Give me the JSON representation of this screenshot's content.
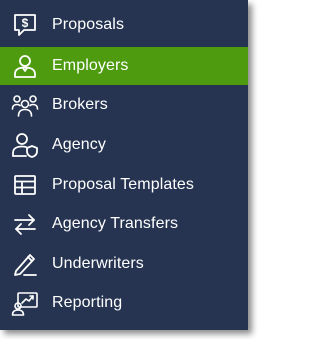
{
  "menu": {
    "items": [
      {
        "label": "Proposals",
        "icon": "proposals-icon",
        "active": false
      },
      {
        "label": "Employers",
        "icon": "employers-icon",
        "active": true
      },
      {
        "label": "Brokers",
        "icon": "brokers-icon",
        "active": false
      },
      {
        "label": "Agency",
        "icon": "agency-icon",
        "active": false
      },
      {
        "label": "Proposal Templates",
        "icon": "proposal-templates-icon",
        "active": false
      },
      {
        "label": "Agency Transfers",
        "icon": "agency-transfers-icon",
        "active": false
      },
      {
        "label": "Underwriters",
        "icon": "underwriters-icon",
        "active": false
      },
      {
        "label": "Reporting",
        "icon": "reporting-icon",
        "active": false
      }
    ],
    "colors": {
      "background": "#263451",
      "active": "#4e9b0f",
      "text": "#ffffff"
    }
  }
}
